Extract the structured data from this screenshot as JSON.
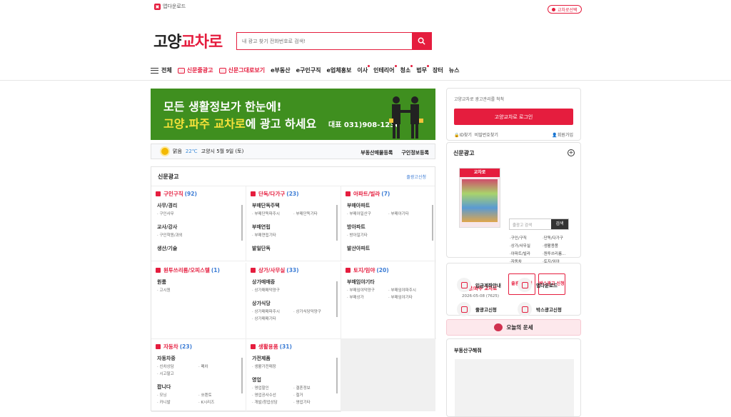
{
  "top": {
    "app_download": "앱다운로드",
    "region_select": "교차로선택"
  },
  "logo": {
    "part1": "고양",
    "part2": "교차로"
  },
  "search": {
    "placeholder": "내 광고 찾기 전화번호로 검색!"
  },
  "nav": {
    "all": "전체",
    "items": [
      "신문줄광고",
      "신문그대로보기",
      "e부동산",
      "e구인구직",
      "e업체홍보",
      "이사",
      "인테리어",
      "청소",
      "법무",
      "장터",
      "뉴스"
    ]
  },
  "banner": {
    "line1": "모든 생활정보가 한눈에!",
    "line2_region": "고양.파주 교차로",
    "line2_rest": "에 광고 하세요",
    "phone": "대표 031)908-1236"
  },
  "weather": {
    "status": "맑음",
    "temp": "22℃",
    "location_date": "고양시 5월 9일 (토)",
    "links": [
      "부동산매물등록",
      "구인정보등록"
    ]
  },
  "ads": {
    "title": "신문광고",
    "apply": "줄광고신청",
    "sections": [
      {
        "title": "구인구직",
        "count": "92",
        "groups": [
          {
            "cat": "사무/경리",
            "subs": [
              "구인사무"
            ]
          },
          {
            "cat": "교사/강사",
            "subs": [
              "구인학원/과외"
            ]
          },
          {
            "cat": "생산/기술",
            "subs": []
          }
        ]
      },
      {
        "title": "단독/다가구",
        "count": "23",
        "groups": [
          {
            "cat": "부매단독주택",
            "subs": [
              "부매단독파주시",
              "부매단독기타"
            ]
          },
          {
            "cat": "부매연립",
            "subs": [
              "부매연립기타"
            ]
          },
          {
            "cat": "발일단독",
            "subs": []
          }
        ]
      },
      {
        "title": "아파트/빌라",
        "count": "7",
        "groups": [
          {
            "cat": "부매아파트",
            "subs": [
              "부매아일산구",
              "부매아기타"
            ]
          },
          {
            "cat": "방아파트",
            "subs": [
              "방아일기타"
            ]
          },
          {
            "cat": "발산아파트",
            "subs": []
          }
        ]
      },
      {
        "title": "원투쓰리룸/오피스텔",
        "count": "1",
        "groups": [
          {
            "cat": "원룸",
            "subs": [
              "고시원"
            ]
          }
        ]
      },
      {
        "title": "상가/사무실",
        "count": "33",
        "groups": [
          {
            "cat": "상가매매중",
            "subs": [
              "상가매매덕양구"
            ]
          },
          {
            "cat": "상가식당",
            "subs": [
              "상가매매파주시",
              "상가식당덕양구",
              "상가매매기타"
            ]
          }
        ]
      },
      {
        "title": "토지/임야",
        "count": "20",
        "groups": [
          {
            "cat": "부매임야기타",
            "subs": [
              "부매임야덕양구",
              "부매임야파주시",
              "부매상가",
              "부매임야기타"
            ]
          }
        ]
      },
      {
        "title": "자동차",
        "count": "23",
        "groups": [
          {
            "cat": "자동차중",
            "subs": [
              "신차상담",
              "폐차",
              "시고팔고"
            ]
          },
          {
            "cat": "팝니다",
            "subs": [
              "모닝",
              "쏘렌토",
              "카니발",
              "K시리즈"
            ]
          }
        ]
      },
      {
        "title": "생활용품",
        "count": "31",
        "groups": [
          {
            "cat": "가전제품",
            "subs": [
              "생활가전매장"
            ]
          },
          {
            "cat": "영업",
            "subs": [
              "영업할인",
              "결혼정보",
              "영업공사수선",
              "철거",
              "개발/창업상담",
              "영업기타"
            ]
          }
        ]
      }
    ]
  },
  "login": {
    "desc": "고양교차로 광고관리를 척척",
    "button": "고양교차로 로그인",
    "find_id": "ID찾기",
    "find_pw": "비밀번호찾기",
    "signup": "회원가입"
  },
  "paper": {
    "title": "신문광고",
    "header": "교차로",
    "caption": "고양/파주 교차로",
    "date": "2026-05-08 (7625)",
    "search_placeholder": "줄광고 검색",
    "search_btn": "검색",
    "list": [
      "구인/구직",
      "단독/다가구",
      "상가/사무실",
      "생활용품",
      "아파트/빌라",
      "원투쓰리룸...",
      "자동차",
      "토지/임야"
    ],
    "btn1": "줄광고 신청",
    "btn2": "박스광고 신청"
  },
  "quick": [
    {
      "label": "입금계좌안내",
      "icon": "monitor-icon"
    },
    {
      "label": "앱다운로드",
      "icon": "phone-icon"
    },
    {
      "label": "줄광고신청",
      "icon": "pencil-icon"
    },
    {
      "label": "박스광고신청",
      "icon": "document-icon"
    }
  ],
  "fortune": "오늘의 운세",
  "solve": {
    "title": "부동산구해줘"
  },
  "colors": {
    "accent": "#e51d3e",
    "banner_bg": "#3f8f1f",
    "link_blue": "#3a7bd5"
  }
}
